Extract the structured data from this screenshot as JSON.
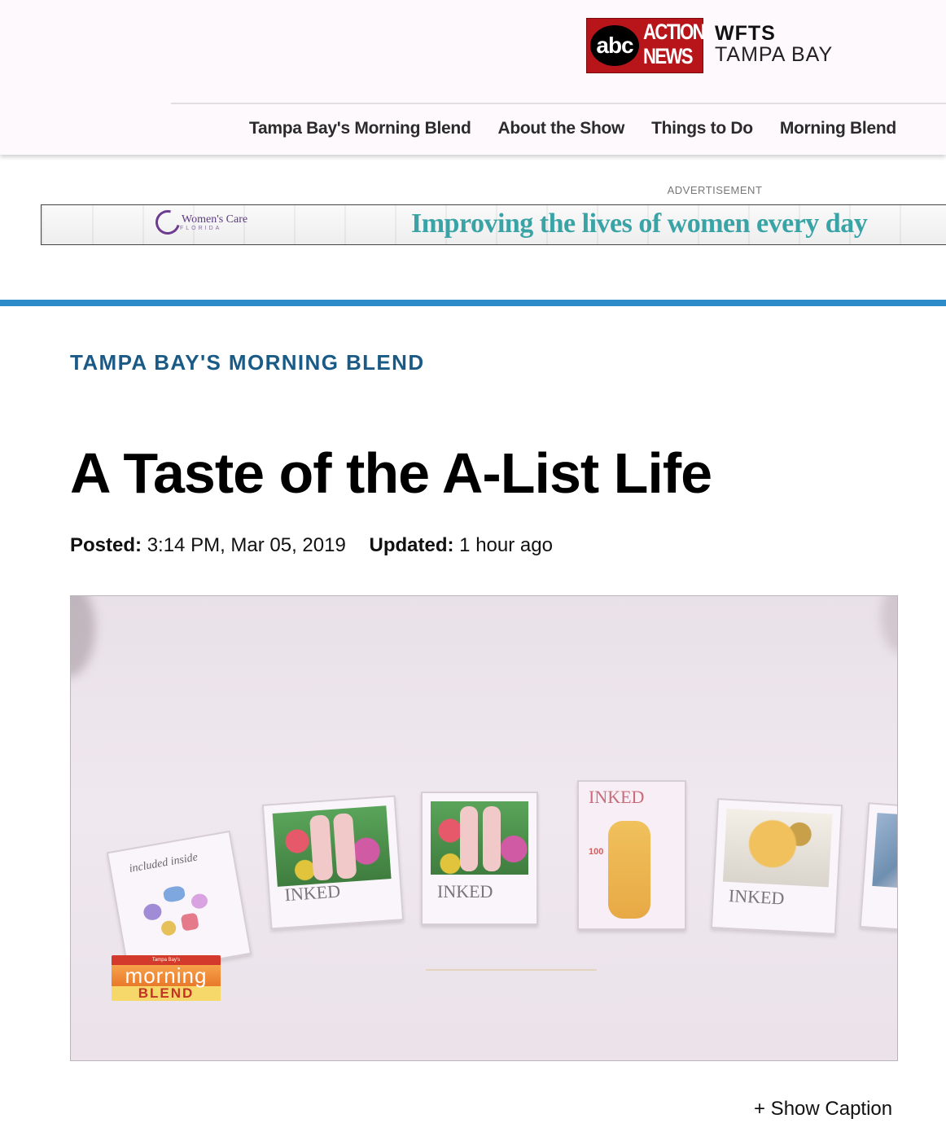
{
  "header": {
    "logo": {
      "abc": "abc",
      "action": "ACTION",
      "news": "NEWS"
    },
    "station_call": "WFTS",
    "station_market": "TAMPA BAY",
    "nav": [
      "Tampa Bay's Morning Blend",
      "About the Show",
      "Things to Do",
      "Morning Blend"
    ]
  },
  "ad": {
    "label": "ADVERTISEMENT",
    "brand": "Women's Care",
    "brand_sub": "FLORIDA",
    "slogan": "Improving the lives of women every day"
  },
  "article": {
    "section": "TAMPA BAY'S MORNING BLEND",
    "title": "A Taste of the A-List Life",
    "posted_label": "Posted:",
    "posted_value": "3:14 PM, Mar 05, 2019",
    "updated_label": "Updated:",
    "updated_value": "1 hour ago",
    "caption_toggle": "+ Show Caption"
  },
  "video": {
    "overlay_top": "Tampa Bay's",
    "overlay_mid": "morning",
    "overlay_bot": "BLEND",
    "card_brand": "INKED",
    "card_count": "100",
    "card_included": "included inside"
  },
  "colors": {
    "section_blue": "#1a5a86",
    "rule_blue": "#2e8bc9",
    "abc_red": "#b8151b",
    "ad_teal": "#3aa3a6"
  }
}
